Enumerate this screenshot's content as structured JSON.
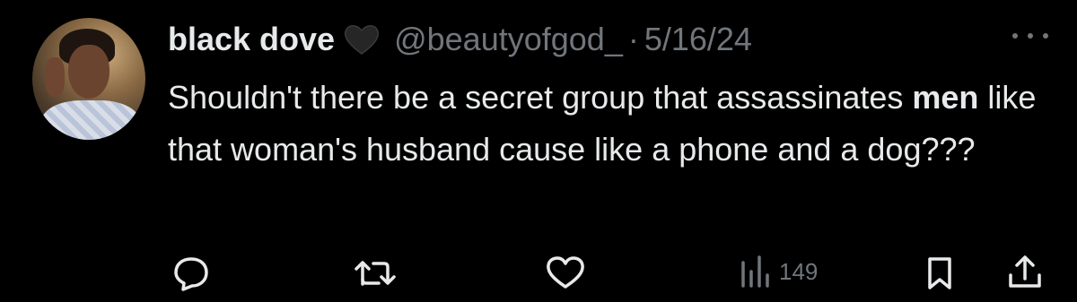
{
  "tweet": {
    "display_name": "black dove",
    "emoji": "black-heart",
    "handle": "@beautyofgod_",
    "separator": "·",
    "date": "5/16/24",
    "text_before": "Shouldn't there be a secret group that assassinates ",
    "text_bold": "men",
    "text_after": " like that woman's husband cause like a phone and a dog???"
  },
  "actions": {
    "reply_icon": "comment-icon",
    "retweet_icon": "retweet-icon",
    "like_icon": "heart-icon",
    "views_icon": "views-icon",
    "views_count": "149",
    "bookmark_icon": "bookmark-icon",
    "share_icon": "share-icon"
  },
  "colors": {
    "background": "#000000",
    "primary_text": "#e7e9ea",
    "secondary_text": "#71767b"
  }
}
